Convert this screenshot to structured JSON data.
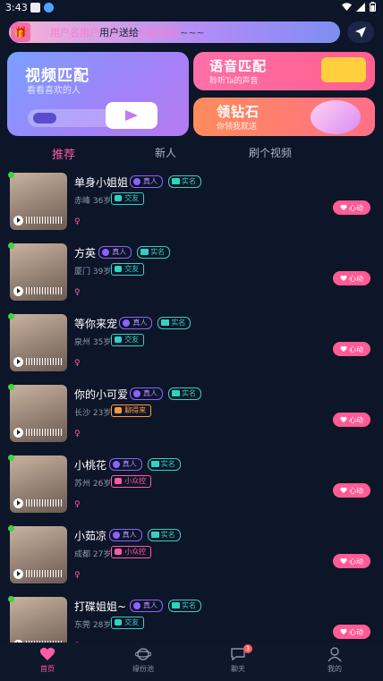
{
  "status": {
    "time": "3:43"
  },
  "notice": {
    "user": "用户名用户",
    "mid": "用户送给",
    "gift": "打碟姐姐",
    "tail": "~~~"
  },
  "banners": {
    "video": {
      "title": "视频匹配",
      "subtitle": "看看喜欢的人"
    },
    "voice": {
      "title": "语音匹配",
      "subtitle": "聆听Ta的声音"
    },
    "diamond": {
      "title": "领钻石",
      "subtitle": "你领我就送"
    }
  },
  "tabs": [
    {
      "label": "推荐",
      "active": true
    },
    {
      "label": "新人",
      "active": false
    },
    {
      "label": "刷个视频",
      "active": false
    }
  ],
  "users": [
    {
      "name": "单身小姐姐",
      "real": "真人",
      "verified": "实名",
      "location": "赤峰 36岁",
      "tag": "交友",
      "tag_style": "teal",
      "gender": "♀",
      "action": "心动"
    },
    {
      "name": "方英",
      "real": "真人",
      "verified": "实名",
      "location": "厦门 39岁",
      "tag": "交友",
      "tag_style": "teal",
      "gender": "♀",
      "action": "心动"
    },
    {
      "name": "等你来宠",
      "real": "真人",
      "verified": "实名",
      "location": "泉州 35岁",
      "tag": "交友",
      "tag_style": "teal",
      "gender": "♀",
      "action": "心动"
    },
    {
      "name": "你的小可爱",
      "real": "真人",
      "verified": "实名",
      "location": "长沙 23岁",
      "tag": "聊得来",
      "tag_style": "orange",
      "gender": "♀",
      "action": "心动"
    },
    {
      "name": "小桃花",
      "real": "真人",
      "verified": "实名",
      "location": "苏州 26岁",
      "tag": "小众控",
      "tag_style": "pink",
      "gender": "♀",
      "action": "心动"
    },
    {
      "name": "小茹凉",
      "real": "真人",
      "verified": "实名",
      "location": "成都 27岁",
      "tag": "小众控",
      "tag_style": "pink",
      "gender": "♀",
      "action": "心动"
    },
    {
      "name": "打碟姐姐~",
      "real": "真人",
      "verified": "实名",
      "location": "东莞 28岁",
      "tag": "交友",
      "tag_style": "teal",
      "gender": "♀",
      "action": "心动"
    }
  ],
  "nav": [
    {
      "label": "首页",
      "icon": "heart-icon",
      "active": true
    },
    {
      "label": "缘份池",
      "icon": "planet-icon",
      "active": false
    },
    {
      "label": "聊天",
      "icon": "chat-icon",
      "active": false,
      "badge": "3"
    },
    {
      "label": "我的",
      "icon": "person-icon",
      "active": false
    }
  ],
  "colors": {
    "accent": "#ff5ba8",
    "background": "#0d1528",
    "online": "#3bd641"
  }
}
